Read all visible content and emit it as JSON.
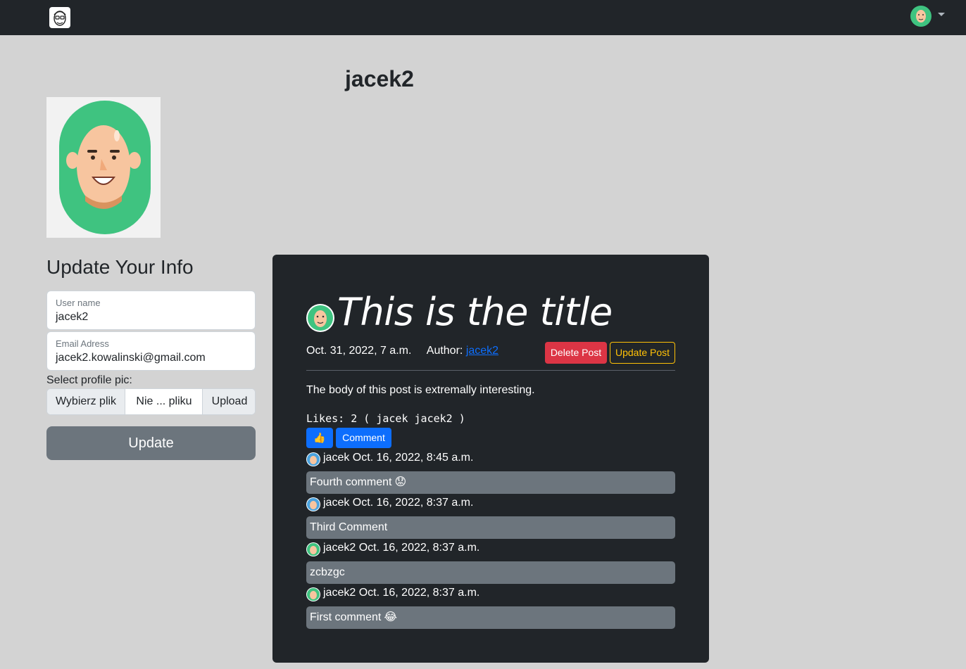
{
  "navbar": {
    "brand_icon": "sketch-face-logo-icon",
    "avatar_icon": "user-avatar-icon",
    "caret_icon": "caret-down-icon"
  },
  "profile": {
    "username": "jacek2",
    "picture_icon": "bald-man-avatar-icon"
  },
  "form": {
    "title": "Update Your Info",
    "username_label": "User name",
    "username_value": "jacek2",
    "email_label": "Email Adress",
    "email_value": "jacek2.kowalinski@gmail.com",
    "pic_label": "Select profile pic:",
    "choose_file_label": "Wybierz plik",
    "file_name": "Nie ... pliku",
    "upload_label": "Upload",
    "submit_label": "Update"
  },
  "post": {
    "title": "This is the title",
    "date": "Oct. 31, 2022, 7 a.m.",
    "author_label": "Author:",
    "author": "jacek2",
    "delete_label": "Delete Post",
    "update_label": "Update Post",
    "body": "The body of this post is extremally interesting.",
    "likes_text": "Likes: 2 ( jacek jacek2 )",
    "like_icon": "👍",
    "comment_label": "Comment",
    "comments": [
      {
        "author": "jacek",
        "date": "Oct. 16, 2022, 8:45 a.m.",
        "text": "Fourth comment",
        "emoji": "😟",
        "avatar_color": "#4aa3df"
      },
      {
        "author": "jacek",
        "date": "Oct. 16, 2022, 8:37 a.m.",
        "text": "Third Comment",
        "emoji": "",
        "avatar_color": "#4aa3df"
      },
      {
        "author": "jacek2",
        "date": "Oct. 16, 2022, 8:37 a.m.",
        "text": "zcbzgc",
        "emoji": "",
        "avatar_color": "#3fc380"
      },
      {
        "author": "jacek2",
        "date": "Oct. 16, 2022, 8:37 a.m.",
        "text": "First comment",
        "emoji": "😂",
        "avatar_color": "#3fc380"
      }
    ]
  },
  "colors": {
    "page_bg": "#d3d3d3",
    "navbar_bg": "#212529",
    "card_bg": "#212529",
    "primary": "#0d6efd",
    "danger": "#dc3545",
    "warning": "#ffc107",
    "secondary": "#6c757d",
    "avatar_green": "#3fc380"
  }
}
